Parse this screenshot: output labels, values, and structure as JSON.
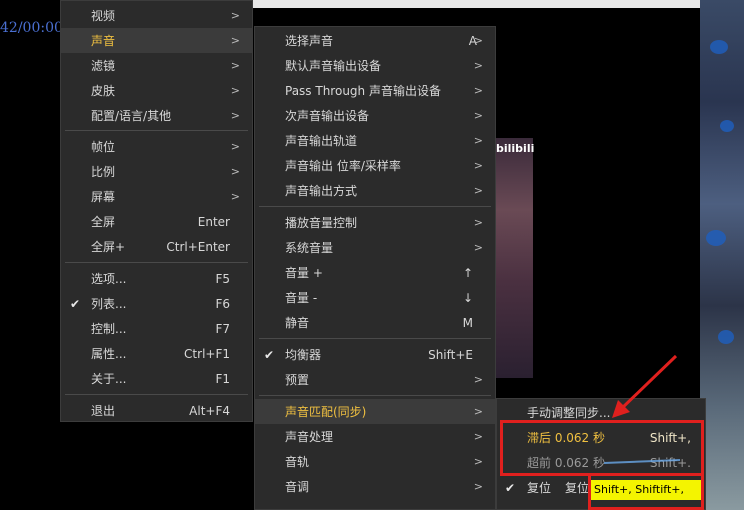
{
  "background": {
    "timecode": "42/00:00"
  },
  "video": {
    "watermark": "bilibili"
  },
  "menu_main": {
    "items": [
      {
        "label": "视频",
        "shortcut": "",
        "arrow": true
      },
      {
        "label": "声音",
        "shortcut": "",
        "arrow": true,
        "highlight": true
      },
      {
        "label": "滤镜",
        "shortcut": "",
        "arrow": true
      },
      {
        "label": "皮肤",
        "shortcut": "",
        "arrow": true
      },
      {
        "label": "配置/语言/其他",
        "shortcut": "",
        "arrow": true
      },
      {
        "label": "帧位",
        "shortcut": "",
        "arrow": true
      },
      {
        "label": "比例",
        "shortcut": "",
        "arrow": true
      },
      {
        "label": "屏幕",
        "shortcut": "",
        "arrow": true
      },
      {
        "label": "全屏",
        "shortcut": "Enter",
        "arrow": false
      },
      {
        "label": "全屏+",
        "shortcut": "Ctrl+Enter",
        "arrow": false
      },
      {
        "label": "选项...",
        "shortcut": "F5",
        "arrow": false
      },
      {
        "label": "列表...",
        "shortcut": "F6",
        "arrow": false,
        "checked": true
      },
      {
        "label": "控制...",
        "shortcut": "F7",
        "arrow": false
      },
      {
        "label": "属性...",
        "shortcut": "Ctrl+F1",
        "arrow": false
      },
      {
        "label": "关于...",
        "shortcut": "F1",
        "arrow": false
      },
      {
        "label": "退出",
        "shortcut": "Alt+F4",
        "arrow": false
      }
    ]
  },
  "menu_audio": {
    "items": [
      {
        "label": "选择声音",
        "shortcut": "A",
        "arrow": true
      },
      {
        "label": "默认声音输出设备",
        "shortcut": "",
        "arrow": true
      },
      {
        "label": "Pass Through 声音输出设备",
        "shortcut": "",
        "arrow": true
      },
      {
        "label": "次声音输出设备",
        "shortcut": "",
        "arrow": true
      },
      {
        "label": "声音输出轨道",
        "shortcut": "",
        "arrow": true
      },
      {
        "label": "声音输出 位率/采样率",
        "shortcut": "",
        "arrow": true
      },
      {
        "label": "声音输出方式",
        "shortcut": "",
        "arrow": true
      },
      {
        "label": "播放音量控制",
        "shortcut": "",
        "arrow": true
      },
      {
        "label": "系统音量",
        "shortcut": "",
        "arrow": true
      },
      {
        "label": "音量 +",
        "shortcut": "↑",
        "arrow": false
      },
      {
        "label": "音量 -",
        "shortcut": "↓",
        "arrow": false
      },
      {
        "label": "静音",
        "shortcut": "M",
        "arrow": false
      },
      {
        "label": "均衡器",
        "shortcut": "Shift+E",
        "arrow": false,
        "checked": true
      },
      {
        "label": "预置",
        "shortcut": "",
        "arrow": true
      },
      {
        "label": "声音匹配(同步)",
        "shortcut": "",
        "arrow": true,
        "highlight": true
      },
      {
        "label": "声音处理",
        "shortcut": "",
        "arrow": true
      },
      {
        "label": "音轨",
        "shortcut": "",
        "arrow": true
      },
      {
        "label": "音调",
        "shortcut": "",
        "arrow": true
      }
    ]
  },
  "menu_sync": {
    "items": [
      {
        "label": "手动调整同步...",
        "shortcut": ""
      },
      {
        "label": "滞后 0.062 秒",
        "shortcut": "Shift+,",
        "highlight": true
      },
      {
        "label": "超前 0.062 秒",
        "shortcut": "Shift+.",
        "muted": true
      },
      {
        "label": "复位",
        "shortcut": "复位",
        "checked": true
      }
    ]
  },
  "tooltip": {
    "text": "Shift+, Shiftift+,"
  }
}
